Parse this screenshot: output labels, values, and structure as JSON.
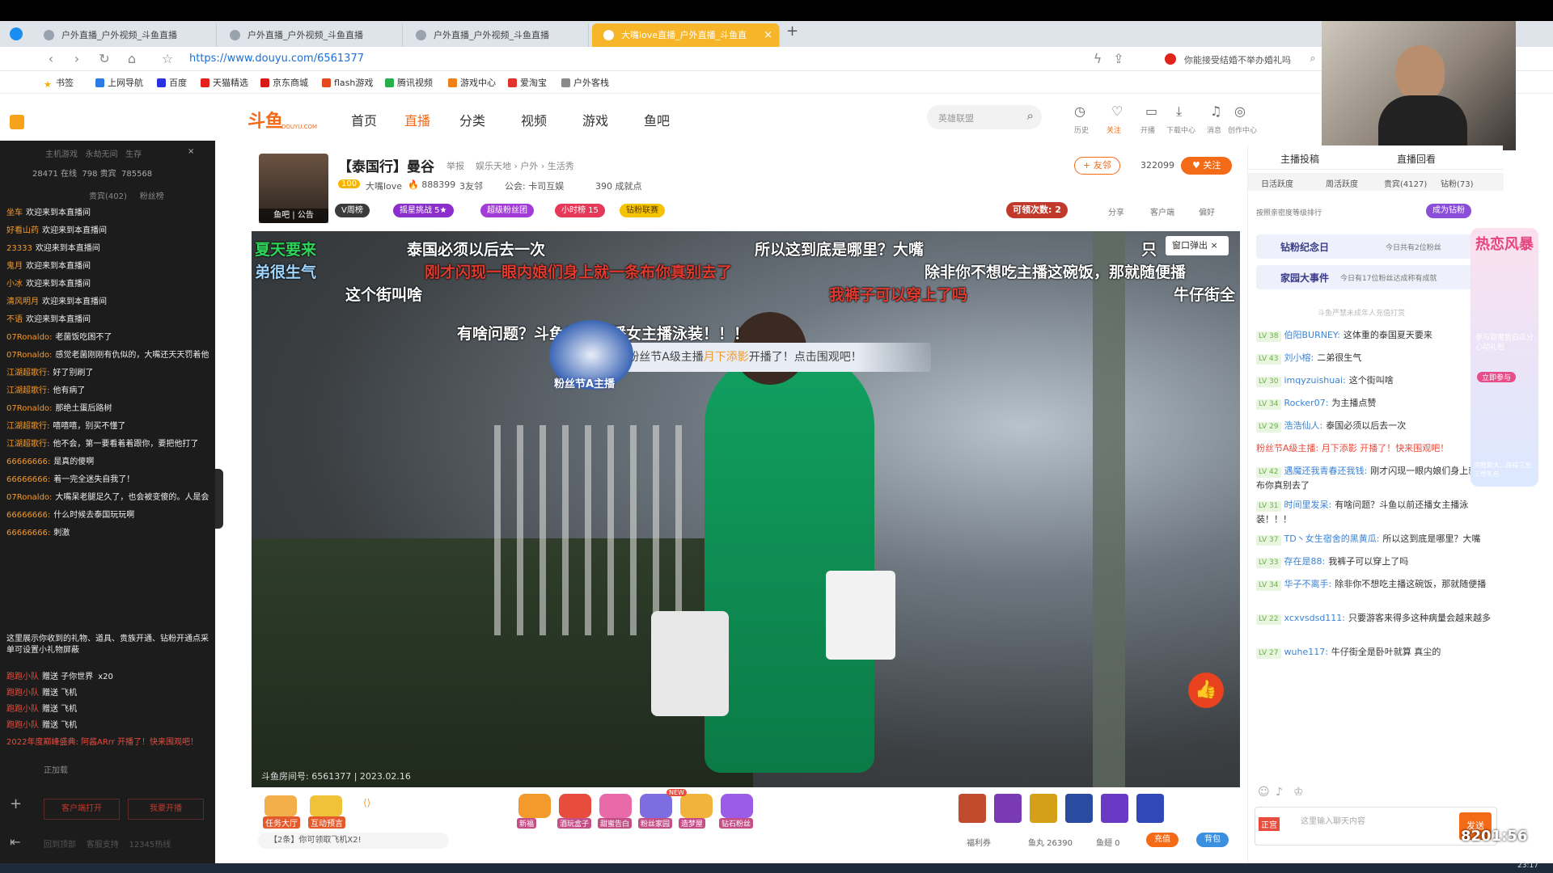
{
  "browser": {
    "tabs": [
      {
        "label": "户外直播_户外视频_斗鱼直播"
      },
      {
        "label": "户外直播_户外视频_斗鱼直播"
      },
      {
        "label": "户外直播_户外视频_斗鱼直播"
      },
      {
        "label": "大嘴love直播_户外直播_斗鱼直"
      }
    ],
    "new_tab": "+",
    "url": "https://www.douyu.com/6561377",
    "search_hint": "你能接受结婚不举办婚礼吗",
    "bookmarks": [
      "书签",
      "上网导航",
      "百度",
      "天猫精选",
      "京东商城",
      "flash游戏",
      "腾讯视频",
      "游戏中心",
      "爱淘宝",
      "户外客栈"
    ]
  },
  "site": {
    "logo": "斗鱼",
    "logo_sub": "DOUYU.COM",
    "nav": [
      "首页",
      "直播",
      "分类",
      "视频",
      "游戏",
      "鱼吧"
    ],
    "search_placeholder": "英雄联盟",
    "header_icons": [
      "历史",
      "关注",
      "开播",
      "下载中心",
      "消息",
      "创作中心"
    ]
  },
  "streamer": {
    "title": "【泰国行】曼谷",
    "report": "举报",
    "category": "娱乐天地 › 户外 › 生活秀",
    "level": "100",
    "name": "大嘴love",
    "hot": "888399",
    "friends": "3友邻",
    "notice": "公会: 卡司互娱",
    "achievements": "390 成就点",
    "avatar_tags": [
      "鱼吧",
      "公告"
    ],
    "badges": [
      "V周榜",
      "摇星挑战 5★",
      "超级粉丝团",
      "小时榜 15",
      "钻粉联赛"
    ],
    "friends_btn": "友邻",
    "followers": "322099",
    "follow_btn": "关注",
    "claim": "可领次数:",
    "claim_count": "2",
    "actions": [
      "分享",
      "客户端",
      "偏好"
    ]
  },
  "video": {
    "room_info": "斗鱼房间号: 6561377 | 2023.02.16",
    "popup": "窗口弹出",
    "notice_prefix": "粉丝节A级主播",
    "notice_name": "月下添影",
    "notice_suffix": "开播了！点击围观吧！",
    "fan_badge": "粉丝节A主播",
    "danmu": [
      {
        "text": "夏天要来",
        "color": "#2fd45a"
      },
      {
        "text": "泰国必须以后去一次",
        "color": "#ffffff"
      },
      {
        "text": "所以这到底是哪里？大嘴",
        "color": "#ffffff"
      },
      {
        "text": "只",
        "color": "#ffffff"
      },
      {
        "text": "弟很生气",
        "color": "#9fd6ff"
      },
      {
        "text": "刚才闪现一眼内娘们身上就一条布你真别去了",
        "color": "#e03a2e"
      },
      {
        "text": "除非你不想吃主播这碗饭，那就随便播",
        "color": "#ffffff"
      },
      {
        "text": "这个街叫啥",
        "color": "#ffffff"
      },
      {
        "text": "我裤子可以穿上了吗",
        "color": "#e03a2e"
      },
      {
        "text": "牛仔街全",
        "color": "#ffffff"
      },
      {
        "text": "有啥问题？斗鱼以前还播女主播泳装！！！",
        "color": "#ffffff"
      }
    ]
  },
  "gifts": {
    "left": [
      "任务大厅",
      "互动预言"
    ],
    "items": [
      "新福",
      "酒玩盒子",
      "甜蜜告白",
      "粉丝家园",
      "造梦屋",
      "钻石粉丝"
    ],
    "new_badge": "NEW",
    "hint": "【2条】你可领取飞机X2!",
    "welfare": "福利券",
    "fishball": "鱼丸 26390",
    "fishfin": "鱼翅 0",
    "recharge": "充值",
    "bag": "背包"
  },
  "left_chat": {
    "header": [
      "主机游戏",
      "永劫无间",
      "生存"
    ],
    "stats": [
      "28471 在线",
      "798 贵宾",
      "785568"
    ],
    "tabs": [
      "贵宾(402)",
      "粉丝榜"
    ],
    "lines": [
      {
        "user": "坐车",
        "text": "欢迎来到本直播间"
      },
      {
        "user": "好看山药",
        "text": "欢迎来到本直播间"
      },
      {
        "user": "23333",
        "text": "欢迎来到本直播间"
      },
      {
        "user": "鬼月",
        "text": "欢迎来到本直播间"
      },
      {
        "user": "小冰",
        "text": "欢迎来到本直播间"
      },
      {
        "user": "清风明月",
        "text": "欢迎来到本直播间"
      },
      {
        "user": "不语",
        "text": "欢迎来到本直播间"
      },
      {
        "user": "07Ronaldo:",
        "text": "老菌饭吃困不了"
      },
      {
        "user": "07Ronaldo:",
        "text": "感觉老菌刚刚有仇似的，大嘴还天天罚着他，也是服了大嘴自己还生气"
      },
      {
        "user": "江湖超歌行:",
        "text": "好了别刷了"
      },
      {
        "user": "江湖超歌行:",
        "text": "他有病了"
      },
      {
        "user": "07Ronaldo:",
        "text": "那绝土蛋后路树"
      },
      {
        "user": "江湖超歌行:",
        "text": "嘻嘻嘻，别买不懂了"
      },
      {
        "user": "江湖超歌行:",
        "text": "他不会，第一要看着着跟你，要把他打了"
      },
      {
        "user": "66666666:",
        "text": "是真的傻啊"
      },
      {
        "user": "66666666:",
        "text": "着一完全迷失自我了！"
      },
      {
        "user": "07Ronaldo:",
        "text": "大嘴呆老腿足久了，也会被变傻的。人是会传染的"
      },
      {
        "user": "66666666:",
        "text": "什么时候去泰国玩玩啊"
      },
      {
        "user": "66666666:",
        "text": "刺激"
      }
    ],
    "gift_notice": "这里展示你收到的礼物、道具、贵族开通、钻粉开通点采单可设置小礼物屏蔽",
    "gift_lines": [
      {
        "user": "跑跑小队",
        "text": "赠送 子你世界",
        "count": "x20"
      },
      {
        "user": "跑跑小队",
        "text": "赠送 飞机"
      },
      {
        "user": "跑跑小队",
        "text": "赠送 飞机"
      },
      {
        "user": "跑跑小队",
        "text": "赠送 飞机"
      }
    ],
    "promo": "2022年度巅峰盛典: 阿酱ARrr 开播了！快来围观吧！",
    "bottom_buttons": [
      "客户端打开",
      "我要开播"
    ],
    "bottom_links": [
      "回到顶部",
      "客服支持",
      "12345热线"
    ],
    "loading": "正加载"
  },
  "right_panel": {
    "tabs_top": [
      "主播投稿",
      "直播回看"
    ],
    "rank_tabs": [
      "日活跃度",
      "周活跃度",
      "贵宾(4127)",
      "钻粉(73)"
    ],
    "rank_hint": "按照亲密度等级排行",
    "become_diamond": "成为钻粉",
    "diamond_day": "钻粉纪念日",
    "diamond_day_sub": "今日共有2位粉丝",
    "family": "家园大事件",
    "family_sub": "今日有17位粉丝达成称有成就",
    "warn": "斗鱼严禁未成年人充值打赏",
    "msgs": [
      {
        "lv": "LV 38",
        "name": "伯阳BURNEY:",
        "text": "这体重的泰国夏天要来"
      },
      {
        "lv": "LV 43",
        "name": "刘小榕:",
        "text": "二弟很生气"
      },
      {
        "lv": "LV 30",
        "name": "imqyzuishuai:",
        "text": "这个街叫啥"
      },
      {
        "lv": "LV 34",
        "name": "Rocker07:",
        "text": "为主播点赞"
      },
      {
        "lv": "LV 29",
        "name": "浩浩仙人:",
        "text": "泰国必须以后去一次"
      },
      {
        "lv": "",
        "name": "粉丝节A级主播: 月下添影 开播了！快来围观吧！",
        "text": ""
      },
      {
        "lv": "LV 42",
        "name": "遇魔还我青春还我钱:",
        "text": "刚才闪现一眼内娘们身上就一条布你真别去了"
      },
      {
        "lv": "LV 31",
        "name": "时间里发呆:",
        "text": "有啥问题？斗鱼以前还播女主播泳装！！！"
      },
      {
        "lv": "LV 37",
        "name": "TD丶女生宿舍的黑黄瓜:",
        "text": "所以这到底是哪里？大嘴"
      },
      {
        "lv": "LV 33",
        "name": "存在是88:",
        "text": "我裤子可以穿上了吗"
      },
      {
        "lv": "LV 34",
        "name": "华子不离手:",
        "text": "除非你不想吃主播这碗饭，那就随便播"
      },
      {
        "lv": "LV 22",
        "name": "xcxvsdsd111:",
        "text": "只要游客来得多这种病量会越来越多"
      },
      {
        "lv": "LV 27",
        "name": "wuhe117:",
        "text": "牛仔街全是卧叶就算 真尘的"
      }
    ],
    "input_placeholder": "这里输入聊天内容",
    "send": "发送",
    "noble_tag": "正宫",
    "side_promo": [
      "热恋风暴",
      "参与甜蜜告白瓜分心动礼包",
      "立即参与",
      "完胜斯大...获得三生三世礼包"
    ]
  },
  "overlay": {
    "clock": "23:17",
    "counter": "8201:56"
  }
}
